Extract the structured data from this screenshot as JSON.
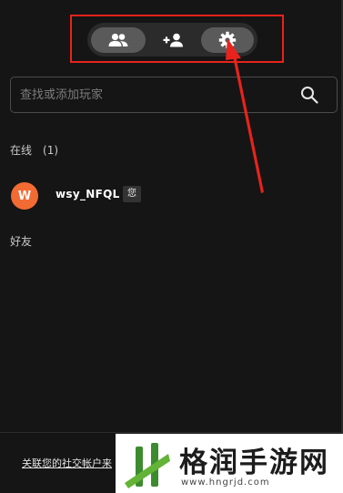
{
  "tabs": [
    {
      "id": "friends",
      "icon": "people-icon",
      "active": true
    },
    {
      "id": "add-friend",
      "icon": "person-add-icon",
      "active": false
    },
    {
      "id": "settings",
      "icon": "gear-icon",
      "active": true
    }
  ],
  "search": {
    "placeholder": "查找或添加玩家",
    "icon": "search-icon"
  },
  "online_section": {
    "title": "在线",
    "count": "(1)"
  },
  "players": [
    {
      "avatar_letter": "W",
      "name": "wsy_NFQL",
      "badge": "您",
      "avatar_color": "#f26b33"
    }
  ],
  "friends_section": {
    "title": "好友"
  },
  "footer": {
    "link_text": "关联您的社交帐户来"
  },
  "watermark": {
    "title": "格润手游网",
    "url": "www.hngrjd.com"
  },
  "colors": {
    "panel_bg": "#151515",
    "tab_active": "#5a5a5a",
    "annotation_red": "#e8231d",
    "avatar": "#f26b33"
  }
}
